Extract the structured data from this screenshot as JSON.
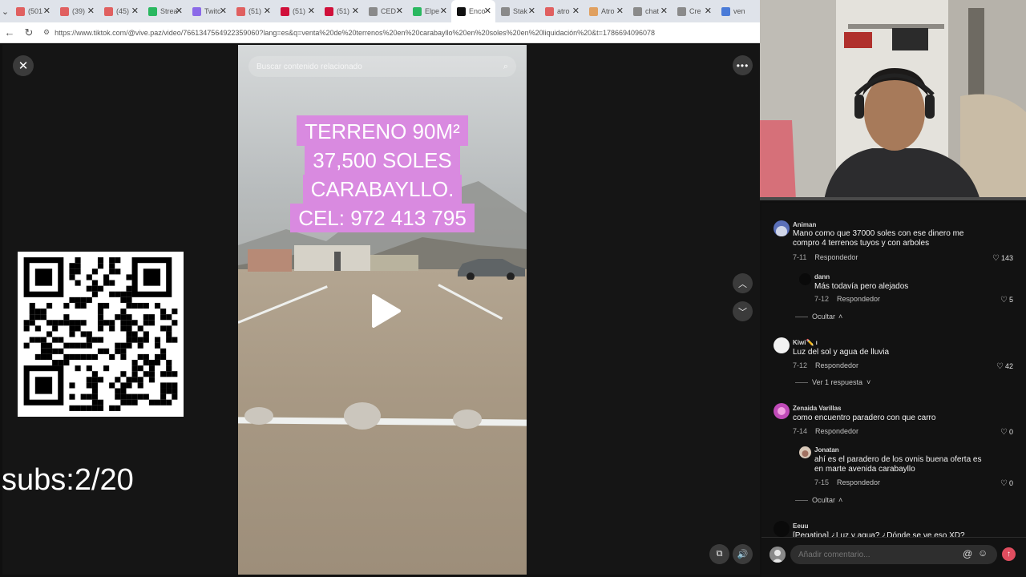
{
  "browser": {
    "tabs": [
      {
        "label": "(501",
        "icon": "youtube-icon",
        "color": "#e06060",
        "active": false
      },
      {
        "label": "(39)",
        "icon": "youtube-icon",
        "color": "#e06060",
        "active": false
      },
      {
        "label": "(45)",
        "icon": "youtube-icon",
        "color": "#e06060",
        "active": false
      },
      {
        "label": "Strea",
        "icon": "kick-icon",
        "color": "#2ab860",
        "active": false
      },
      {
        "label": "Twitc",
        "icon": "twitch-icon",
        "color": "#8b6ae8",
        "active": false
      },
      {
        "label": "(51)",
        "icon": "youtube-icon",
        "color": "#e06060",
        "active": false
      },
      {
        "label": "(51) ",
        "icon": "youtube-icon",
        "color": "#d0103a",
        "active": false
      },
      {
        "label": "(51)",
        "icon": "youtube-icon",
        "color": "#d0103a",
        "active": false
      },
      {
        "label": "CED",
        "icon": "check-icon",
        "color": "#8a8a8a",
        "active": false
      },
      {
        "label": "Elpe",
        "icon": "kick-icon",
        "color": "#2ab860",
        "active": false
      },
      {
        "label": "Enco",
        "icon": "tiktok-icon",
        "color": "#111111",
        "active": true
      },
      {
        "label": "Stak",
        "icon": "stake-icon",
        "color": "#8a8a8a",
        "active": false
      },
      {
        "label": "atro",
        "icon": "site-icon",
        "color": "#e06060",
        "active": false
      },
      {
        "label": "Atro",
        "icon": "site-icon",
        "color": "#e0a060",
        "active": false
      },
      {
        "label": "chat",
        "icon": "search-icon",
        "color": "#8a8a8a",
        "active": false
      },
      {
        "label": "Cre",
        "icon": "globe-icon",
        "color": "#8a8a8a",
        "active": false
      },
      {
        "label": "ven",
        "icon": "search-icon",
        "color": "#4a7bd8",
        "active": false
      }
    ],
    "url": "https://www.tiktok.com/@vive.paz/video/7661347564922359060?lang=es&q=venta%20de%20terrenos%20en%20carabayllo%20en%20soles%20en%20liquidación%20&t=1786694096078"
  },
  "video": {
    "search_placeholder": "Buscar contenido relacionado",
    "overlay_lines": [
      "TERRENO 90M²",
      "37,500 SOLES",
      "CARABAYLLO.",
      "CEL: 972 413 795"
    ]
  },
  "stream": {
    "subs_label": "subs:2/20"
  },
  "comments": [
    {
      "user": "Animan",
      "text": "Mano como que 37000 soles con ese dinero me compro 4 terrenos tuyos y con arboles",
      "date": "7-11",
      "reply_label": "Respondedor",
      "likes": "143",
      "avatar_color": "#5a6fb8",
      "reply": false
    },
    {
      "user": "dann",
      "text": "Más todavía pero alejados",
      "date": "7-12",
      "reply_label": "Respondedor",
      "likes": "5",
      "avatar_color": "#0a0a0a",
      "reply": true
    },
    {
      "user": "Kiwi✏️ ı",
      "text": "Luz del sol y agua de lluvia",
      "date": "7-12",
      "reply_label": "Respondedor",
      "likes": "42",
      "avatar_color": "#f2f2f2",
      "reply": false
    },
    {
      "user": "Zenaida Varillas",
      "text": "como encuentro paradero con que carro",
      "date": "7-14",
      "reply_label": "Respondedor",
      "likes": "0",
      "avatar_color": "#c04ab8",
      "reply": false
    },
    {
      "user": "Jonatan",
      "text": "ahí es el paradero de los ovnis buena oferta es en marte avenida carabayllo",
      "date": "7-15",
      "reply_label": "Respondedor",
      "likes": "0",
      "avatar_color": "#d8c8b8",
      "reply": true
    },
    {
      "user": "Eeuu",
      "text": "[Pegatina] ¿Luz y agua? ¿Dónde se ve eso XD?",
      "avatar_color": "#0a0a0a",
      "reply": false
    }
  ],
  "toggles": {
    "hide_1": "Ocultar",
    "view_replies": "Ver 1 respuesta",
    "hide_2": "Ocultar"
  },
  "comment_input": {
    "placeholder": "Añadir comentario..."
  },
  "colors": {
    "overlay_bg": "#d98ae0",
    "send": "#e04d5f",
    "panel_bg": "#121212"
  }
}
